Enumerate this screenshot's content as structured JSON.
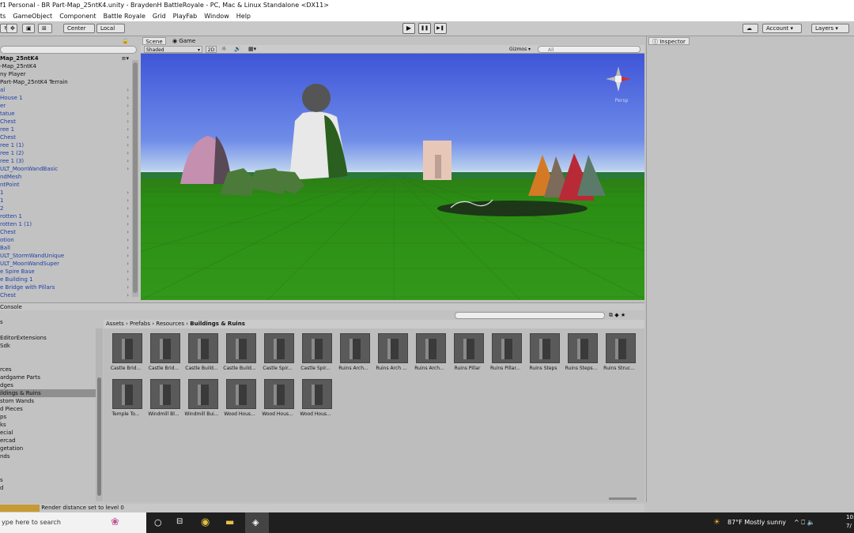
{
  "window": {
    "title": "f1 Personal - BR Part-Map_25ntK4.unity - BraydenH BattleRoyale - PC, Mac & Linux Standalone <DX11>"
  },
  "menu": [
    "ts",
    "GameObject",
    "Component",
    "Battle Royale",
    "Grid",
    "PlayFab",
    "Window",
    "Help"
  ],
  "toolbar": {
    "center": "Center",
    "local": "Local",
    "play": "▶",
    "pause": "❚❚",
    "step": "▶❚",
    "account": "Account",
    "layers": "Layers"
  },
  "hierarchy": {
    "scene": "Map_25ntK4",
    "rows": [
      {
        "label": "-Map_25ntK4",
        "arrow": false,
        "dark": true
      },
      {
        "label": "ny Player",
        "arrow": false,
        "dark": true
      },
      {
        "label": "Part-Map_25ntK4 Terrain",
        "arrow": false,
        "dark": true
      },
      {
        "label": "al",
        "arrow": true
      },
      {
        "label": "House 1",
        "arrow": true
      },
      {
        "label": "er",
        "arrow": true
      },
      {
        "label": "tatue",
        "arrow": true
      },
      {
        "label": "Chest",
        "arrow": true
      },
      {
        "label": "ree 1",
        "arrow": true
      },
      {
        "label": "Chest",
        "arrow": true
      },
      {
        "label": "ree 1 (1)",
        "arrow": true
      },
      {
        "label": "ree 1 (2)",
        "arrow": true
      },
      {
        "label": "ree 1 (3)",
        "arrow": true
      },
      {
        "label": "ULT_MoonWandBasic",
        "arrow": true
      },
      {
        "label": "ndMesh",
        "arrow": false
      },
      {
        "label": "ntPoint",
        "arrow": false
      },
      {
        "label": "1",
        "arrow": true
      },
      {
        "label": "1",
        "arrow": true
      },
      {
        "label": "2",
        "arrow": true
      },
      {
        "label": "rotten 1",
        "arrow": true
      },
      {
        "label": "rotten 1 (1)",
        "arrow": true
      },
      {
        "label": "Chest",
        "arrow": true
      },
      {
        "label": "otion",
        "arrow": true
      },
      {
        "label": "Ball",
        "arrow": true
      },
      {
        "label": "ULT_StormWandUnique",
        "arrow": true
      },
      {
        "label": "ULT_MoonWandSuper",
        "arrow": true
      },
      {
        "label": "e Spire Base",
        "arrow": true
      },
      {
        "label": "e Building 1",
        "arrow": true
      },
      {
        "label": "e Bridge with Pillars",
        "arrow": true
      },
      {
        "label": "Chest",
        "arrow": true
      }
    ]
  },
  "scene": {
    "tab_scene": "Scene",
    "tab_game": "Game",
    "shaded": "Shaded",
    "mode2d": "2D",
    "gizmos": "Gizmos",
    "search_placeholder": "All",
    "persp": "Persp"
  },
  "inspector": {
    "tab": "Inspector"
  },
  "console": {
    "tab": "Console"
  },
  "project": {
    "breadcrumb": [
      "Assets",
      "Prefabs",
      "Resources",
      "Buildings & Ruins"
    ],
    "tree": [
      {
        "label": "s"
      },
      {
        "label": ""
      },
      {
        "label": "EditorExtensions"
      },
      {
        "label": "Sdk"
      },
      {
        "label": ""
      },
      {
        "label": ""
      },
      {
        "label": "rces"
      },
      {
        "label": "ardgame Parts"
      },
      {
        "label": "dges"
      },
      {
        "label": "ildings & Ruins",
        "selected": true
      },
      {
        "label": "stom Wands"
      },
      {
        "label": "d Pieces"
      },
      {
        "label": "ps"
      },
      {
        "label": "ks"
      },
      {
        "label": "ecial"
      },
      {
        "label": "ercad"
      },
      {
        "label": "getation"
      },
      {
        "label": "nds"
      },
      {
        "label": ""
      },
      {
        "label": ""
      },
      {
        "label": "s"
      },
      {
        "label": "d"
      }
    ],
    "assets": [
      "Castle Brid...",
      "Castle Brid...",
      "Castle Build...",
      "Castle Build...",
      "Castle Spir...",
      "Castle Spir...",
      "Ruins Arch...",
      "Ruins Arch ...",
      "Ruins Arch...",
      "Ruins Pillar",
      "Ruins Pillar...",
      "Ruins Steps",
      "Ruins Steps...",
      "Ruins Struc...",
      "Temple To...",
      "Windmill Bl...",
      "Windmill Bui...",
      "Wood Hous...",
      "Wood Hous...",
      "Wood Hous..."
    ]
  },
  "status": {
    "text": "Render distance set to level 0"
  },
  "taskbar": {
    "search": "ype here to search",
    "weather": "87°F  Mostly sunny",
    "clock": "10:",
    "date": "7/"
  }
}
